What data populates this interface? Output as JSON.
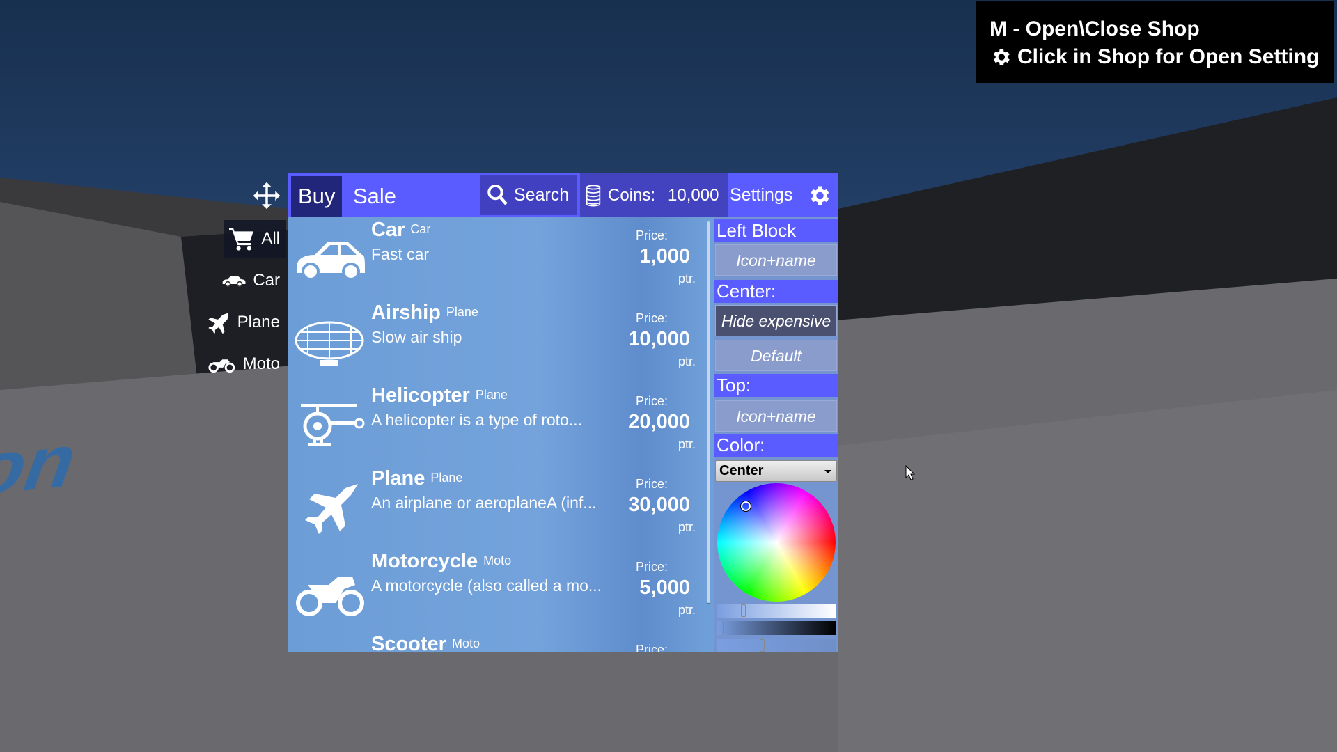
{
  "hint": {
    "line1": "M - Open\\Close Shop",
    "line2": "Click in Shop for Open Setting"
  },
  "categories": [
    {
      "label": "All",
      "icon": "cart-icon",
      "selected": true
    },
    {
      "label": "Car",
      "icon": "car-icon"
    },
    {
      "label": "Plane",
      "icon": "plane-icon"
    },
    {
      "label": "Moto",
      "icon": "moto-icon"
    }
  ],
  "header": {
    "buy": "Buy",
    "sale": "Sale",
    "search": "Search",
    "coins_label": "Coins:",
    "coins_value": "10,000",
    "settings": "Settings"
  },
  "items": [
    {
      "name": "Car",
      "category": "Car",
      "desc": "Fast car",
      "price_label": "Price:",
      "price": "1,000",
      "unit": "ptr.",
      "icon": "car-icon"
    },
    {
      "name": "Airship",
      "category": "Plane",
      "desc": "Slow air ship",
      "price_label": "Price:",
      "price": "10,000",
      "unit": "ptr.",
      "icon": "airship-icon"
    },
    {
      "name": "Helicopter",
      "category": "Plane",
      "desc": "A helicopter is a type of roto...",
      "price_label": "Price:",
      "price": "20,000",
      "unit": "ptr.",
      "icon": "helicopter-icon"
    },
    {
      "name": "Plane",
      "category": "Plane",
      "desc": "An airplane or aeroplaneA (inf...",
      "price_label": "Price:",
      "price": "30,000",
      "unit": "ptr.",
      "icon": "plane-icon"
    },
    {
      "name": "Motorcycle",
      "category": "Moto",
      "desc": "A motorcycle (also called a mo...",
      "price_label": "Price:",
      "price": "5,000",
      "unit": "ptr.",
      "icon": "moto-icon"
    },
    {
      "name": "Scooter",
      "category": "Moto",
      "desc": "",
      "price_label": "Price:",
      "price": "",
      "unit": "",
      "icon": "scooter-icon"
    }
  ],
  "settings": {
    "left_block": "Left Block",
    "left_value": "Icon+name",
    "center": "Center:",
    "center_opt1": "Hide expensive",
    "center_opt2": "Default",
    "top": "Top:",
    "top_value": "Icon+name",
    "color": "Color:",
    "color_target": "Center"
  },
  "colors": {
    "header": "#5a5cff",
    "buy_tab": "#22267a",
    "list_bg": "#6f9fd8"
  }
}
